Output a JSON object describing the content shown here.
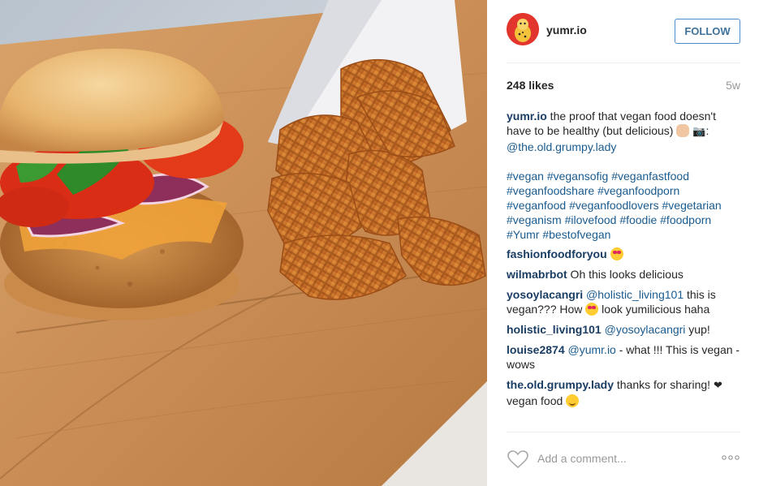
{
  "post": {
    "image_alt": "Vegan burger and waffle fries on a wooden board"
  },
  "header": {
    "username": "yumr.io",
    "follow_label": "FOLLOW"
  },
  "stats": {
    "likes": "248 likes",
    "time_ago": "5w"
  },
  "caption": {
    "username": "yumr.io",
    "text_before": " the proof that vegan food doesn't have to be healthy (but delicious) ",
    "text_after": ": ",
    "mention": "@the.old.grumpy.lady",
    "hashtags": [
      "#vegan",
      "#vegansofig",
      "#veganfastfood",
      "#veganfoodshare",
      "#veganfoodporn",
      "#veganfood",
      "#veganfoodlovers",
      "#vegetarian",
      "#veganism",
      "#ilovefood",
      "#foodie",
      "#foodporn",
      "#Yumr",
      "#bestofvegan"
    ]
  },
  "comments": [
    {
      "username": "fashionfoodforyou",
      "text": " "
    },
    {
      "username": "wilmabrbot",
      "text": " Oh this looks delicious"
    },
    {
      "username": "yosoylacangri",
      "mention": "@holistic_living101",
      "text": " this is vegan??? How ",
      "text2": " look yumilicious haha"
    },
    {
      "username": "holistic_living101",
      "mention": "@yosoylacangri",
      "text": " yup!"
    },
    {
      "username": "louise2874",
      "mention": "@yumr.io",
      "text": " - what !!! This is vegan - wows"
    },
    {
      "username": "the.old.grumpy.lady",
      "text": " thanks for sharing! ",
      "heart": "❤",
      "text2": " vegan food "
    }
  ],
  "add_comment": {
    "placeholder": "Add a comment..."
  },
  "icons": {
    "like": "heart-outline-icon",
    "more": "more-options-icon",
    "camera": "camera-emoji"
  },
  "colors": {
    "username": "#1a3d63",
    "hashtag": "#1a5b8f",
    "follow_border": "#4f8cc9",
    "muted": "#999999"
  }
}
